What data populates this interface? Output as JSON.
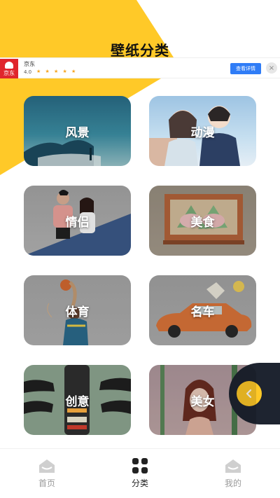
{
  "header": {
    "title": "壁纸分类"
  },
  "ad": {
    "logo_text": "京东",
    "app_name": "京东",
    "rating": "4.0",
    "stars": "★ ★ ★ ★ ★",
    "cta_label": "查看详情",
    "close_glyph": "×"
  },
  "categories": [
    {
      "label": "风景"
    },
    {
      "label": "动漫"
    },
    {
      "label": "情侣"
    },
    {
      "label": "美食"
    },
    {
      "label": "体育"
    },
    {
      "label": "名车"
    },
    {
      "label": "创意"
    },
    {
      "label": "美女"
    }
  ],
  "side_button": {
    "icon": "chevron-left-icon"
  },
  "nav": {
    "items": [
      {
        "label": "首页",
        "icon": "home-icon",
        "active": false
      },
      {
        "label": "分类",
        "icon": "grid-icon",
        "active": true
      },
      {
        "label": "我的",
        "icon": "profile-home-icon",
        "active": false
      }
    ]
  },
  "colors": {
    "accent_yellow": "#FFC928",
    "side_tab_dark": "#1E2430",
    "ad_cta_blue": "#2F7CF6",
    "ad_logo_red": "#E0262C"
  }
}
